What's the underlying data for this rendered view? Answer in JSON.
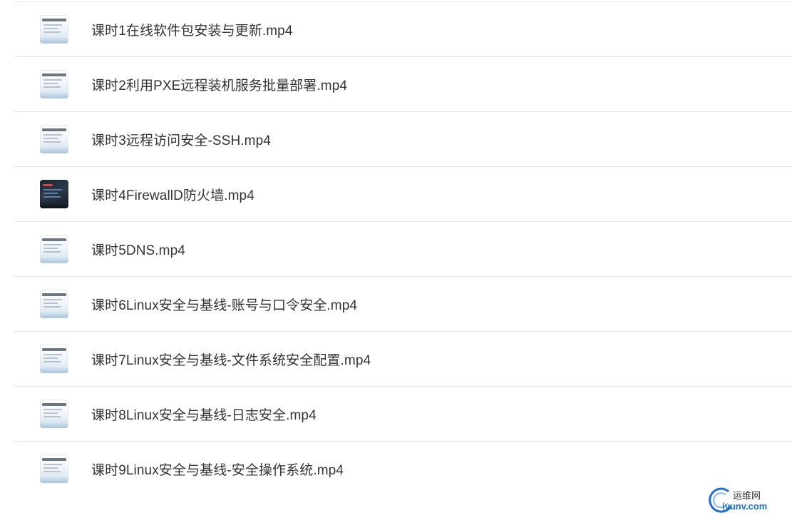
{
  "files": [
    {
      "name": "课时1在线软件包安装与更新.mp4",
      "thumbnail": "document-preview"
    },
    {
      "name": "课时2利用PXE远程装机服务批量部署.mp4",
      "thumbnail": "document-preview"
    },
    {
      "name": "课时3远程访问安全-SSH.mp4",
      "thumbnail": "document-preview"
    },
    {
      "name": "课时4FirewallD防火墙.mp4",
      "thumbnail": "dark-video-preview"
    },
    {
      "name": "课时5DNS.mp4",
      "thumbnail": "document-preview"
    },
    {
      "name": "课时6Linux安全与基线-账号与口令安全.mp4",
      "thumbnail": "document-preview"
    },
    {
      "name": "课时7Linux安全与基线-文件系统安全配置.mp4",
      "thumbnail": "document-preview"
    },
    {
      "name": "课时8Linux安全与基线-日志安全.mp4",
      "thumbnail": "document-preview"
    },
    {
      "name": "课时9Linux安全与基线-安全操作系统.mp4",
      "thumbnail": "document-preview"
    }
  ],
  "watermark": {
    "top_text": "运维网",
    "bottom_text": "iyunv.com"
  },
  "colors": {
    "text": "#333333",
    "divider": "#e6e6e6",
    "watermark_blue": "#1e6fd1"
  }
}
